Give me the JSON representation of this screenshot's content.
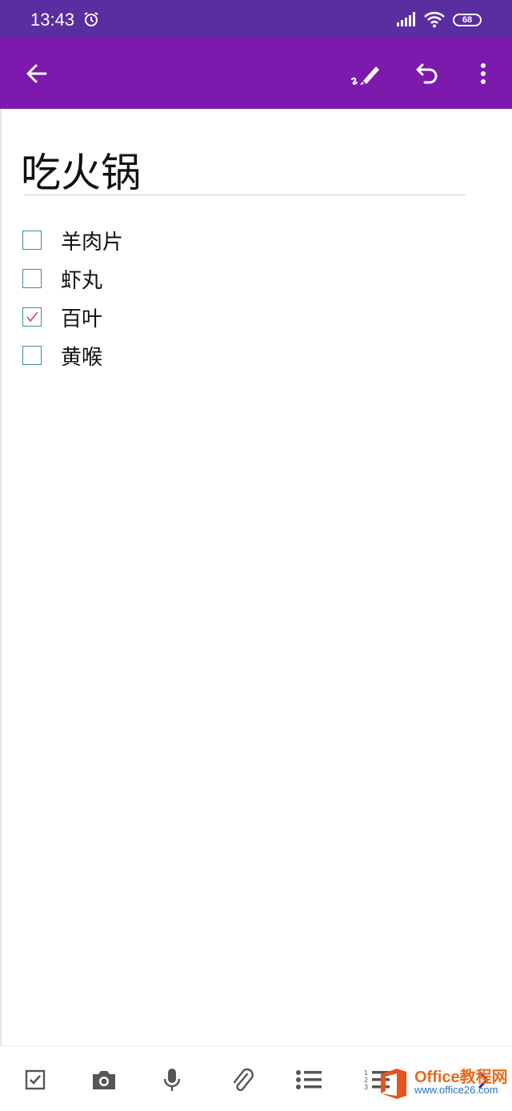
{
  "status_bar": {
    "time": "13:43",
    "battery": "68"
  },
  "app_bar": {
    "back_icon": "arrow-left-icon",
    "ink_icon": "ink-pen-icon",
    "undo_icon": "undo-icon",
    "more_icon": "more-vertical-icon",
    "color": "#7b1aac"
  },
  "note": {
    "title": "吃火锅",
    "items": [
      {
        "label": "羊肉片",
        "checked": false
      },
      {
        "label": "虾丸",
        "checked": false
      },
      {
        "label": "百叶",
        "checked": true
      },
      {
        "label": "黄喉",
        "checked": false
      }
    ]
  },
  "toolbar": {
    "icons": [
      "checkbox-icon",
      "camera-icon",
      "microphone-icon",
      "attach-icon",
      "bullet-list-icon",
      "numbered-list-icon",
      "chevron-right-icon"
    ]
  },
  "watermark": {
    "brand": "Office教程网",
    "url": "www.office26.com"
  }
}
